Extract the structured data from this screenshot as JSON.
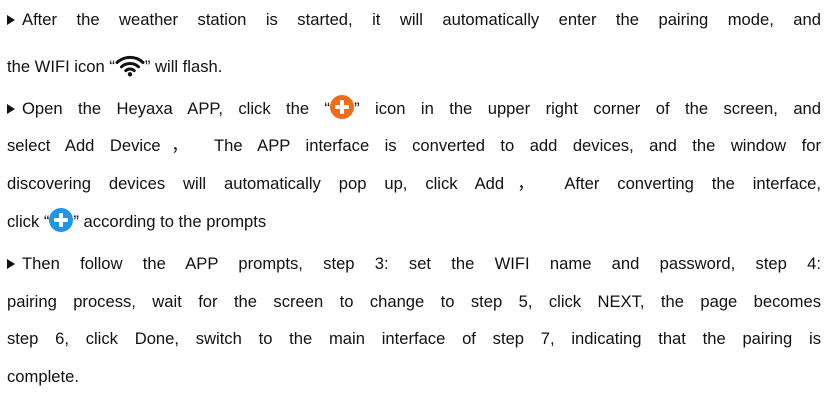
{
  "paragraphs": [
    {
      "lines": [
        {
          "text": "After the weather station is started, it will automatically enter the pairing mode, and"
        },
        {
          "before": "the WIFI icon “",
          "icon": "wifi-icon",
          "after": "” will flash."
        }
      ]
    },
    {
      "lines": [
        {
          "before": "Open the Heyaxa APP, click the “",
          "icon": "add-circle-orange-icon",
          "after": "” icon in the upper right corner of the screen, and"
        },
        {
          "text": "select Add Device， The APP interface is converted to add devices, and the window for"
        },
        {
          "text": "discovering devices will automatically pop up, click Add， After converting the interface,"
        },
        {
          "before": "click “",
          "icon": "add-circle-blue-icon",
          "after": "” according to the prompts"
        }
      ]
    },
    {
      "lines": [
        {
          "text": "Then follow the APP prompts, step 3: set the WIFI name and password, step 4:"
        },
        {
          "text": "pairing process, wait for the screen to change to step 5, click NEXT, the page becomes"
        },
        {
          "text": "step 6, click Done, switch to the main interface of step 7, indicating that the pairing is"
        },
        {
          "text": "complete."
        }
      ]
    }
  ],
  "colors": {
    "text": "#111111",
    "orange_icon": "#ef6d1a",
    "blue_icon": "#1f96e8"
  }
}
